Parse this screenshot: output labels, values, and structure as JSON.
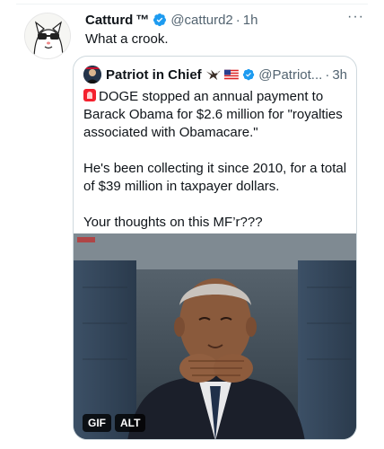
{
  "tweet": {
    "author_name": "Catturd",
    "trademark": "™",
    "handle": "@catturd2",
    "separator": "·",
    "time": "1h",
    "more_label": "···",
    "text": "What a crook."
  },
  "quote": {
    "author_name": "Patriot in Chief",
    "handle": "@Patriot...",
    "separator": "·",
    "time": "3h",
    "paragraphs": [
      "DOGE stopped an annual payment to Barack Obama for $2.6 million for \"royalties associated with Obamacare.\"",
      "He's been collecting it since 2010, for a total of $39 million in taxpayer dollars.",
      "Your thoughts on this MF’r???"
    ],
    "media": {
      "gif_label": "GIF",
      "alt_label": "ALT"
    }
  },
  "colors": {
    "verified_blue": "#1d9bf0",
    "secondary_text": "#536471",
    "border": "#cfd9de"
  }
}
